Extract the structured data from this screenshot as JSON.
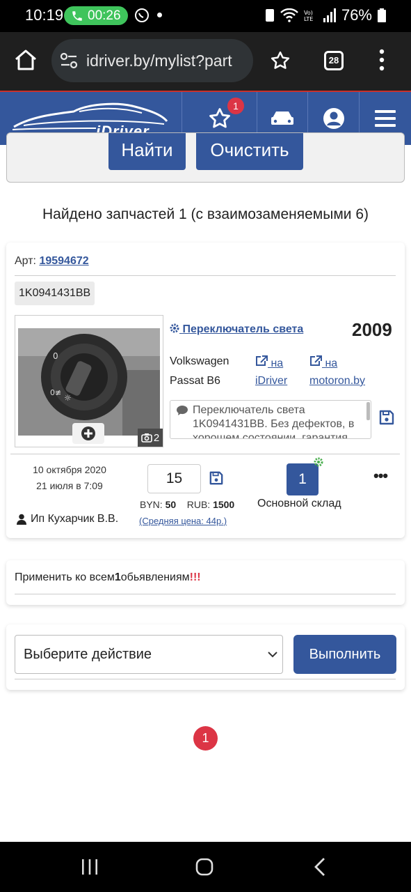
{
  "status_bar": {
    "time": "10:19",
    "call_timer": "00:26",
    "battery": "76%"
  },
  "browser": {
    "url": "idriver.by/mylist?part",
    "tab_count": "28"
  },
  "site_header": {
    "logo_text": "iDriver",
    "favorites_badge": "1"
  },
  "search": {
    "find_label": "Найти",
    "clear_label": "Очистить"
  },
  "results": {
    "summary": "Найдено запчастей 1 (с взаимозаменяемыми 6)"
  },
  "part": {
    "art_label": "Арт:",
    "art_number": "19594672",
    "oem_code": "1K0941431BB",
    "photo_count": "2",
    "title": "Переключатель света",
    "year": "2009",
    "make": "Volkswagen",
    "model": "Passat B6",
    "link_idriver_top": "на",
    "link_idriver_bottom": "iDriver",
    "link_motoron_top": "на",
    "link_motoron_bottom": "motoron.by",
    "description": "Переключатель света 1K0941431BB. Без дефектов, в хорошем состоянии, гарантия",
    "date_created": "10 октября 2020",
    "date_updated": "21 июля в 7:09",
    "seller": "Ип Кухарчик В.В.",
    "quantity": "15",
    "byn_label": "BYN:",
    "byn_value": "50",
    "rub_label": "RUB:",
    "rub_value": "1500",
    "avg_price": "(Средняя цена: 44р.)",
    "stock_count": "1",
    "stock_name": "Основной склад",
    "more_label": "•••"
  },
  "apply": {
    "prefix": "Применить ко всем",
    "count": "1",
    "suffix": "обьявлениям",
    "marks": "!!!"
  },
  "actions": {
    "select_value": "Выберите действие",
    "execute_label": "Выполнить"
  },
  "pagination": {
    "current_page": "1"
  },
  "colors": {
    "brand_blue": "#34579c",
    "danger_red": "#dc3545"
  }
}
